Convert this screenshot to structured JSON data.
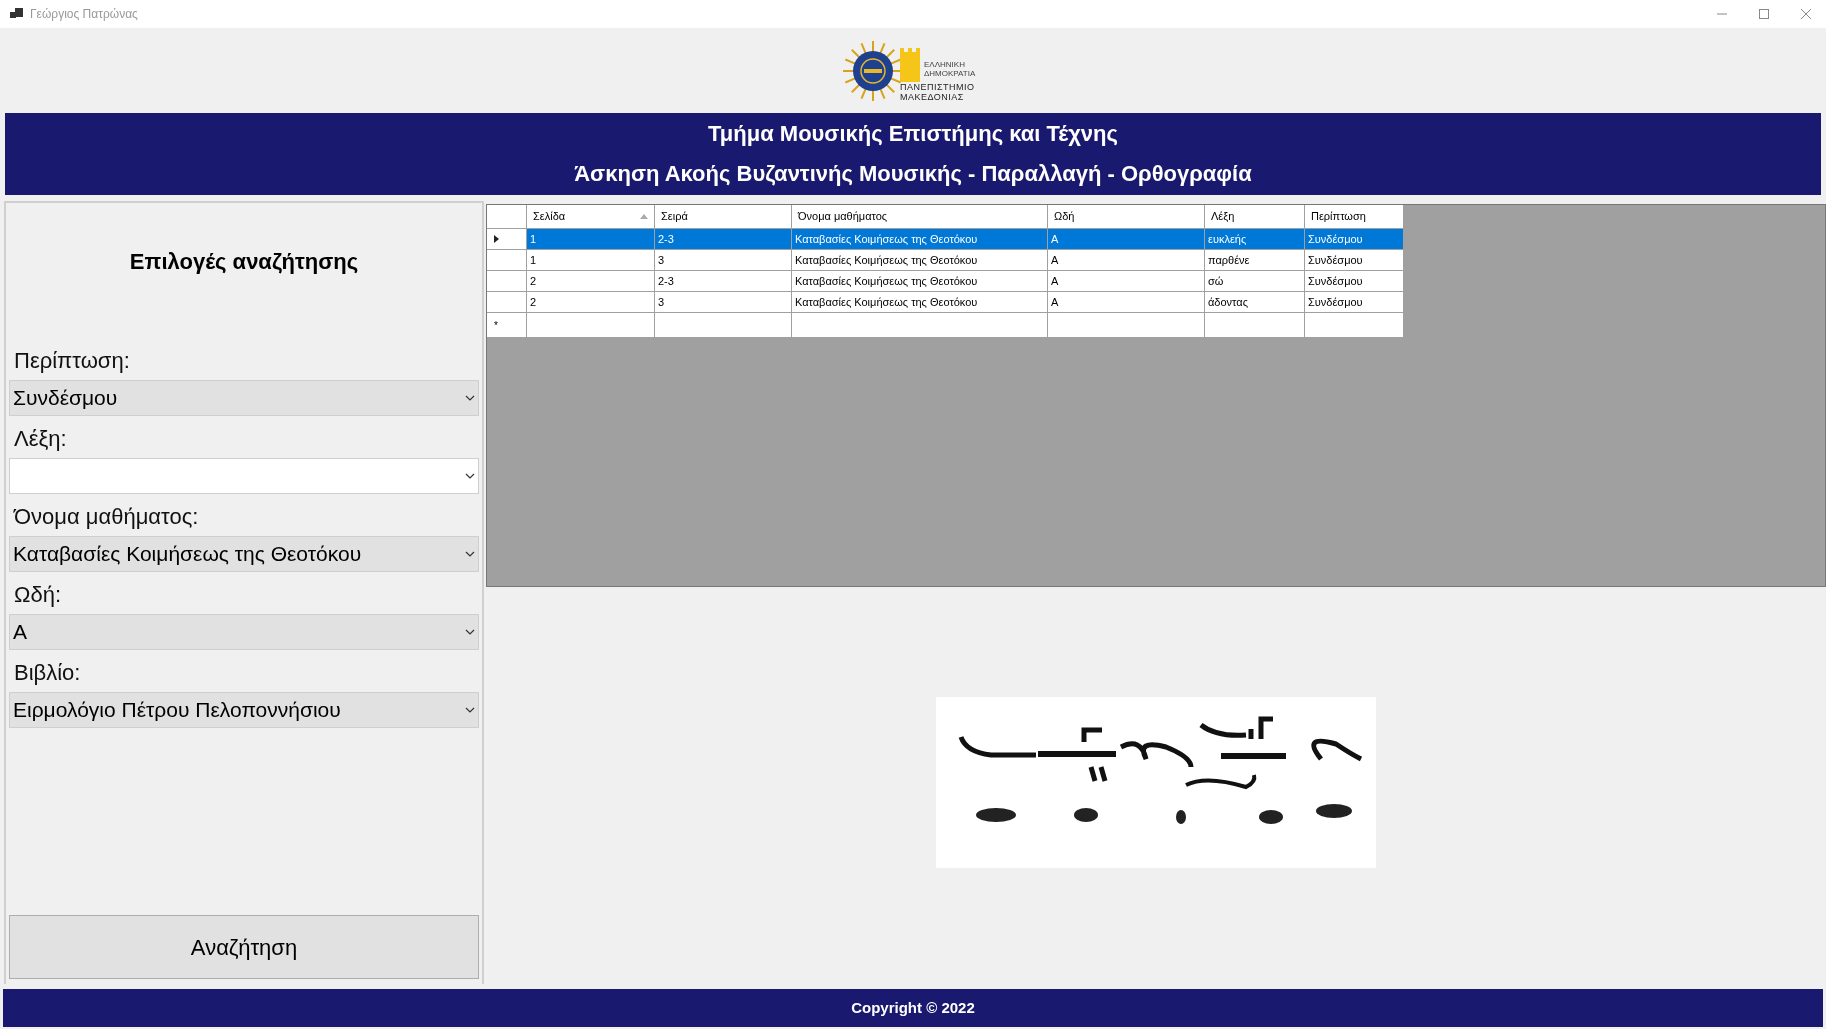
{
  "window": {
    "title": "Γεώργιος Πατρώνας"
  },
  "logo": {
    "top_text": "ΕΛΛΗΝΙΚΗ ΔΗΜΟΚΡΑΤΙΑ",
    "name_lines": [
      "ΠΑΝΕΠΙΣΤΗΜΙΟ",
      "ΜΑΚΕΔΟΝΙΑΣ"
    ]
  },
  "header": {
    "lines": [
      "Τμήμα Μουσικής Επιστήμης και Τέχνης",
      "Άσκηση Ακοής Βυζαντινής Μουσικής - Παραλλαγή - Ορθογραφία"
    ]
  },
  "search_panel": {
    "title": "Επιλογές αναζήτησης",
    "fields": [
      {
        "label": "Περίπτωση:",
        "value": "Συνδέσμου",
        "editable": false
      },
      {
        "label": "Λέξη:",
        "editable": true
      },
      {
        "label": "Όνομα μαθήματος:",
        "value": "Καταβασίες Κοιμήσεως της Θεοτόκου",
        "editable": false
      },
      {
        "label": "Ωδή:",
        "value": "Α",
        "editable": false
      },
      {
        "label": "Βιβλίο:",
        "value": "Ειρμολόγιο Πέτρου Πελοποννήσιου",
        "editable": false
      }
    ],
    "button": "Αναζήτηση"
  },
  "table": {
    "columns": [
      {
        "label": "Σελίδα",
        "sorted": true
      },
      {
        "label": "Σειρά",
        "sorted": false
      },
      {
        "label": "Όνομα μαθήματος",
        "sorted": false
      },
      {
        "label": "Ωδή",
        "sorted": false
      },
      {
        "label": "Λέξη",
        "sorted": false
      },
      {
        "label": "Περίπτωση",
        "sorted": false
      }
    ],
    "rows": [
      {
        "selected": true,
        "cells": [
          "1",
          "2-3",
          "Καταβασίες Κοιμήσεως της Θεοτόκου",
          "Α",
          "ευκλεής",
          "Συνδέσμου"
        ]
      },
      {
        "selected": false,
        "cells": [
          "1",
          "3",
          "Καταβασίες Κοιμήσεως της Θεοτόκου",
          "Α",
          "παρθένε",
          "Συνδέσμου"
        ]
      },
      {
        "selected": false,
        "cells": [
          "2",
          "2-3",
          "Καταβασίες Κοιμήσεως της Θεοτόκου",
          "Α",
          "σώ",
          "Συνδέσμου"
        ]
      },
      {
        "selected": false,
        "cells": [
          "2",
          "3",
          "Καταβασίες Κοιμήσεως της Θεοτόκου",
          "Α",
          "άδοντας",
          "Συνδέσμου"
        ]
      }
    ],
    "new_row_marker": "*"
  },
  "footer": {
    "text": "Copyright © 2022"
  }
}
